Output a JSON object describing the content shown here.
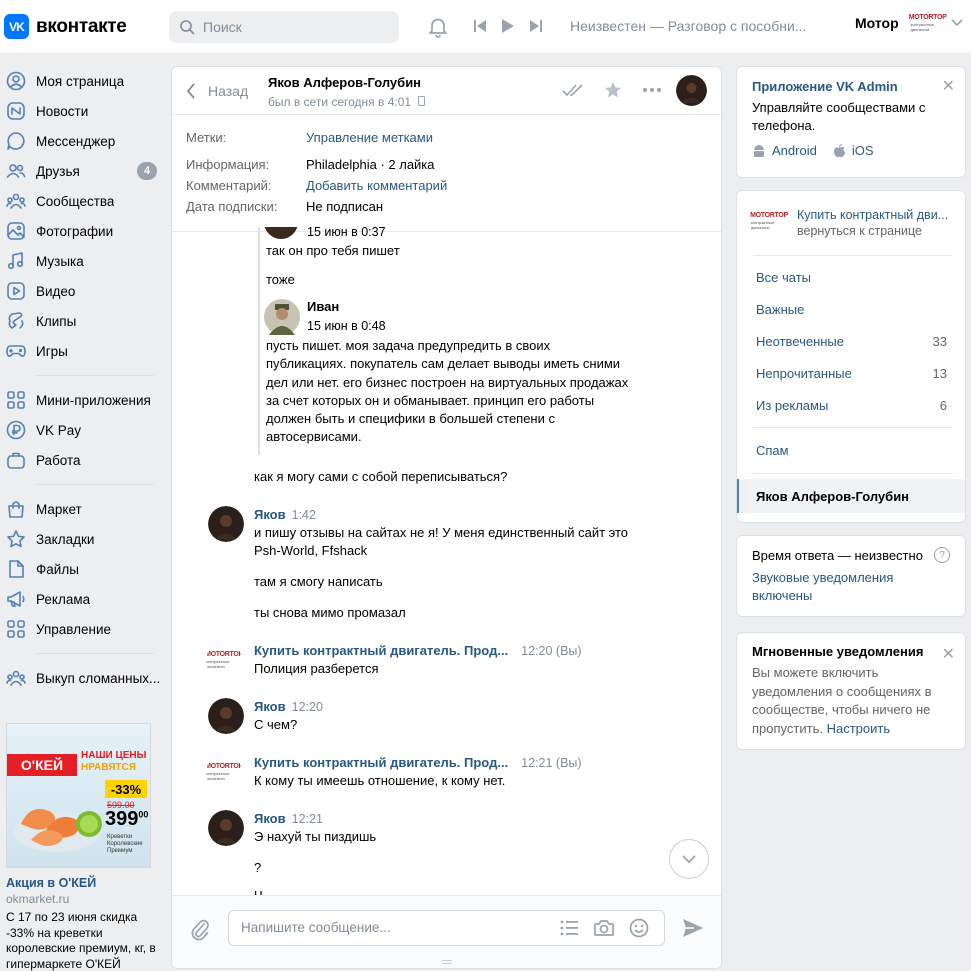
{
  "header": {
    "logo_text": "вконтакте",
    "logo_mark": "VK",
    "search_placeholder": "Поиск",
    "track": "Неизвестен — Разговор с пособни...",
    "user_name": "Мотор"
  },
  "brand": {
    "logo_top": "MOTORTOP",
    "logo_sub": "контрактные двигатели"
  },
  "nav": {
    "items1": [
      {
        "label": "Моя страница",
        "icon": "user-icon"
      },
      {
        "label": "Новости",
        "icon": "news-icon"
      },
      {
        "label": "Мессенджер",
        "icon": "messenger-icon"
      },
      {
        "label": "Друзья",
        "icon": "friends-icon",
        "badge": "4"
      },
      {
        "label": "Сообщества",
        "icon": "communities-icon"
      },
      {
        "label": "Фотографии",
        "icon": "photos-icon"
      },
      {
        "label": "Музыка",
        "icon": "music-icon"
      },
      {
        "label": "Видео",
        "icon": "video-icon"
      },
      {
        "label": "Клипы",
        "icon": "clips-icon"
      },
      {
        "label": "Игры",
        "icon": "games-icon"
      }
    ],
    "items2": [
      {
        "label": "Мини-приложения",
        "icon": "apps-icon"
      },
      {
        "label": "VK Pay",
        "icon": "vkpay-icon"
      },
      {
        "label": "Работа",
        "icon": "work-icon"
      }
    ],
    "items3": [
      {
        "label": "Маркет",
        "icon": "market-icon"
      },
      {
        "label": "Закладки",
        "icon": "bookmarks-icon"
      },
      {
        "label": "Файлы",
        "icon": "files-icon"
      },
      {
        "label": "Реклама",
        "icon": "ads-icon"
      },
      {
        "label": "Управление",
        "icon": "manage-icon"
      }
    ],
    "items4": [
      {
        "label": "Выкуп сломанных...",
        "icon": "group-icon"
      }
    ]
  },
  "ad": {
    "title": "Акция в О'КЕЙ",
    "domain": "okmarket.ru",
    "text": "С 17 по 23 июня скидка -33% на креветки королевские премиум, кг, в гипермаркете О'КЕЙ",
    "img_brand": "О'КЕЙ",
    "img_headline1": "НАШИ ЦЕНЫ",
    "img_headline2": "НРАВЯТСЯ",
    "img_discount": "-33%",
    "img_old_price": "599.00",
    "img_price": "399",
    "img_price_cents": "00",
    "img_product": "Креветки Королевские Премиум"
  },
  "chat": {
    "back": "Назад",
    "peer_name": "Яков Алферов-Голубин",
    "peer_status": "был в сети сегодня в 4:01",
    "info": {
      "tags_k": "Метки:",
      "tags_v": "Управление метками",
      "info_k": "Информация:",
      "info_v": "Philadelphia · 2 лайка",
      "comment_k": "Комментарий:",
      "comment_v": "Добавить комментарий",
      "sub_k": "Дата подписки:",
      "sub_v": "Не подписан"
    },
    "fwd": {
      "top_time": "15 июн в 0:37",
      "line1": "так он про тебя пишет",
      "line2": "тоже",
      "ivan_name": "Иван",
      "ivan_time": "15 июн в 0:48",
      "ivan_text": [
        "пусть пишет. моя задача предупредить в своих",
        "публикациях. покупатель сам делает выводы иметь сними",
        "дел или нет. его бизнес построен на виртуальных продажах",
        "за счет которых он и обманывает. принцип его работы",
        "должен быть и специфики в большей степени с",
        "автосервисами."
      ]
    },
    "m0": "как я могу сами с собой переписываться?",
    "m1": {
      "author": "Яков",
      "time": "1:42",
      "t1": "и пишу отзывы на сайтах не я! У меня единственный сайт это",
      "t2": "Psh-World, Ffshack",
      "t3": "там я смогу написать",
      "t4": "ты снова мимо промазал"
    },
    "m2": {
      "author": "Купить контрактный двигатель. Прод...",
      "time": "12:20 (Вы)",
      "t1": "Полиция разберется"
    },
    "m3": {
      "author": "Яков",
      "time": "12:20",
      "t1": "С чем?"
    },
    "m4": {
      "author": "Купить контрактный двигатель. Прод...",
      "time": "12:21 (Вы)",
      "t1": "К кому ты имеешь отношение, к кому нет."
    },
    "m5": {
      "author": "Яков",
      "time": "12:21",
      "t1": "Э нахуй ты пиздишь",
      "t2": "?",
      "t3": "Ч"
    },
    "composer_placeholder": "Напишите сообщение..."
  },
  "right": {
    "admin_title": "Приложение VK Admin",
    "admin_desc": "Управляйте сообществами с телефона.",
    "android": "Android",
    "ios": "iOS",
    "group_name": "Купить контрактный дви...",
    "group_back": "вернуться к странице",
    "folders": [
      {
        "label": "Все чаты",
        "count": ""
      },
      {
        "label": "Важные",
        "count": ""
      },
      {
        "label": "Неотвеченные",
        "count": "33"
      },
      {
        "label": "Непрочитанные",
        "count": "13"
      },
      {
        "label": "Из рекламы",
        "count": "6"
      }
    ],
    "spam": "Спам",
    "active_chat": "Яков Алферов-Голубин",
    "resp_time": "Время ответа — неизвестно",
    "resp_q": "?",
    "sound": "Звуковые уведомления включены",
    "notif_title": "Мгновенные уведомления",
    "notif_desc": "Вы можете включить уведомления о сообщениях в сообществе, чтобы ничего не пропустить.",
    "notif_link": "Настроить"
  },
  "colors": {
    "accent": "#2a5885",
    "vk_blue": "#0077ff",
    "nav_icon": "#5181b8"
  }
}
